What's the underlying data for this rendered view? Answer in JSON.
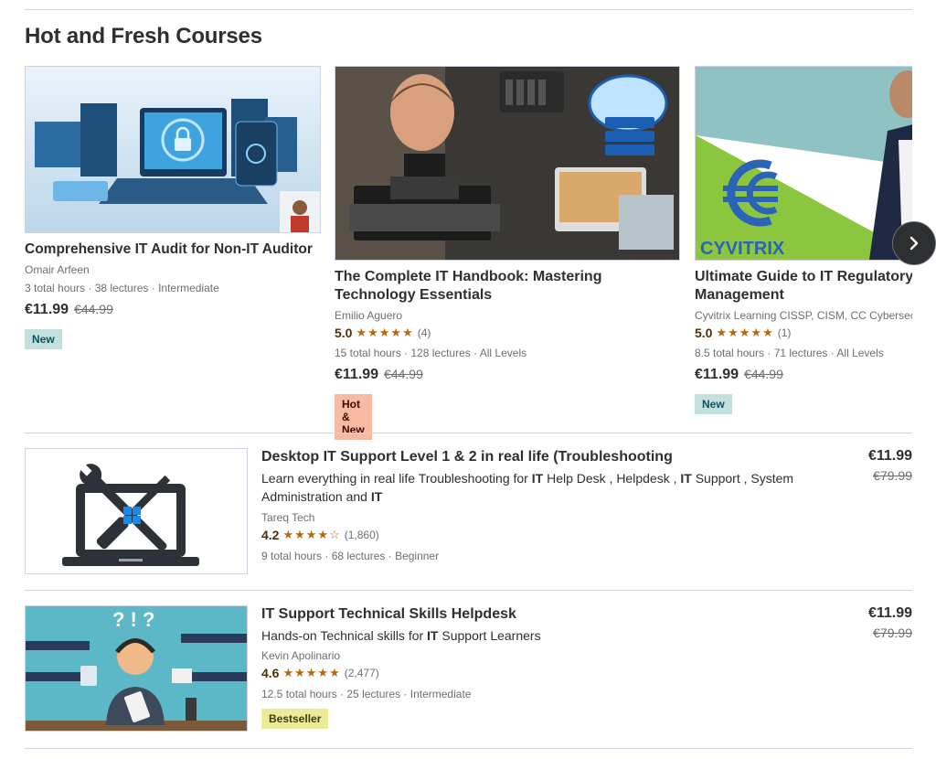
{
  "section": {
    "title": "Hot and Fresh Courses"
  },
  "cards": [
    {
      "title": "Comprehensive IT Audit for Non-IT Auditor",
      "instructor": "Omair Arfeen",
      "meta": "3 total hours · 38 lectures · Intermediate",
      "price": "€11.99",
      "old_price": "€44.99",
      "badge": "New"
    },
    {
      "title_line1": "The Complete IT Handbook: Mastering",
      "title_line2": "Technology Essentials",
      "instructor": "Emilio Aguero",
      "rating": "5.0",
      "stars": "★★★★★",
      "rating_count": "(4)",
      "meta": "15 total hours · 128 lectures · All Levels",
      "price": "€11.99",
      "old_price": "€44.99",
      "badge": "Hot & New"
    },
    {
      "title_line1": "Ultimate Guide to IT Regulatory",
      "title_line2": "Management",
      "instructor": "Cyvitrix Learning CISSP, CISM, CC Cybersec",
      "rating": "5.0",
      "stars": "★★★★★",
      "rating_count": "(1)",
      "meta": "8.5 total hours · 71 lectures · All Levels",
      "price": "€11.99",
      "old_price": "€44.99",
      "badge": "New",
      "thumb_text": "CYVITRIX"
    }
  ],
  "rows": [
    {
      "title": "Desktop IT Support Level 1 & 2 in real life (Troubleshooting",
      "subtitle_parts": [
        "Learn everything in real life Troubleshooting for ",
        "IT",
        " Help Desk , Helpdesk , ",
        "IT",
        " Support , System Administration and ",
        "IT"
      ],
      "instructor": "Tareq Tech",
      "rating": "4.2",
      "stars": "★★★★☆",
      "rating_count": "(1,860)",
      "meta": "9 total hours · 68 lectures · Beginner",
      "price": "€11.99",
      "old_price": "€79.99"
    },
    {
      "title": "IT Support Technical Skills Helpdesk",
      "subtitle_parts": [
        "Hands-on Technical skills for ",
        "IT",
        " Support Learners"
      ],
      "instructor": "Kevin Apolinario",
      "rating": "4.6",
      "stars": "★★★★★",
      "rating_count": "(2,477)",
      "meta": "12.5 total hours · 25 lectures · Intermediate",
      "price": "€11.99",
      "old_price": "€79.99",
      "badge": "Bestseller",
      "thumb_text": "? ! ?"
    }
  ],
  "colors": {
    "star": "#b4690e",
    "text": "#2d2f31",
    "muted": "#6a6f73",
    "divider": "#d1d2e0"
  },
  "icons": {
    "next": "chevron-right-icon"
  }
}
